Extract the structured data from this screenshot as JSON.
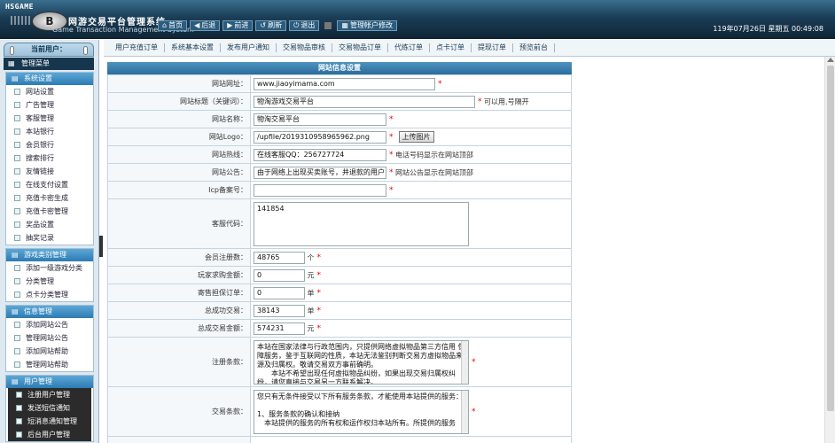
{
  "header": {
    "brand": "HSGAME",
    "logo_letter": "B",
    "title_cn": "网游交易平台管理系统",
    "title_en": "Game Transaction Management System",
    "nav": [
      {
        "icon": "⌂",
        "label": "首页"
      },
      {
        "icon": "◀",
        "label": "后退"
      },
      {
        "icon": "▶",
        "label": "前进"
      },
      {
        "icon": "↺",
        "label": "刷新"
      },
      {
        "icon": "⏻",
        "label": "退出"
      }
    ],
    "account_button": "管理帐户修改",
    "datetime": "119年07月26日 星期五 00:49:08"
  },
  "sidebar": {
    "current_user_label": "当前用户：",
    "menu_title": "管理菜单",
    "groups": [
      {
        "title": "系统设置",
        "items": [
          "网站设置",
          "广告管理",
          "客服管理",
          "本站银行",
          "会员银行",
          "搜索排行",
          "友情链接",
          "在线支付设置",
          "充值卡密生成",
          "充值卡密管理",
          "奖品设置",
          "抽奖记录"
        ]
      },
      {
        "title": "游戏类别管理",
        "items": [
          "添加一级游戏分类",
          "分类管理",
          "点卡分类管理"
        ]
      },
      {
        "title": "信息管理",
        "items": [
          "添加网站公告",
          "管理网站公告",
          "添加网站帮助",
          "管理网站帮助"
        ]
      },
      {
        "title": "用户管理",
        "items": [
          "注册用户管理",
          "发送短信通知",
          "短消息通知管理",
          "后台用户管理"
        ]
      }
    ]
  },
  "tabs": [
    "用户充值订单",
    "系统基本设置",
    "发布用户通知",
    "交易物品审核",
    "交易物品订单",
    "代练订单",
    "点卡订单",
    "提现订单",
    "预览前台"
  ],
  "form": {
    "caption": "网站信息设置",
    "rows": [
      {
        "label": "网站网址：",
        "value": "www.jiaoyimama.com",
        "width": 205,
        "req": true,
        "hint": ""
      },
      {
        "label": "网站标题（关键词）：",
        "value": "物淘游戏交易平台",
        "width": 250,
        "req": true,
        "hint": "可以用,号隔开"
      },
      {
        "label": "网站名称：",
        "value": "物淘交易平台",
        "width": 150,
        "req": true,
        "hint": ""
      },
      {
        "label": "网站Logo：",
        "value": "/upfile/2019310958965962.png",
        "width": 150,
        "req": true,
        "hint": "",
        "button": "上传图片"
      },
      {
        "label": "网站热线：",
        "value": "在线客服QQ：256727724",
        "width": 150,
        "req": true,
        "hint": "电话号码显示在网站顶部"
      },
      {
        "label": "网站公告：",
        "value": "由于网络上出现买卖账号，并退款的用户",
        "width": 150,
        "req": true,
        "hint": "网站公告显示在网站顶部"
      },
      {
        "label": "Icp备案号：",
        "value": "",
        "width": 150,
        "req": true,
        "hint": ""
      }
    ],
    "service_code_label": "客服代码：",
    "service_code_value": "141854",
    "numeric_rows": [
      {
        "label": "会员注册数：",
        "value": "48765",
        "unit": "个"
      },
      {
        "label": "玩家求购金额：",
        "value": "0",
        "unit": "元"
      },
      {
        "label": "寄售担保订单：",
        "value": "0",
        "unit": "单"
      },
      {
        "label": "总成功交易：",
        "value": "38143",
        "unit": "单"
      },
      {
        "label": "总成交易金额：",
        "value": "574231",
        "unit": "元"
      }
    ],
    "terms_label": "注册条款：",
    "terms_text": "本站在国家法律与行政范围内，只提供网络虚拟物品第三方信用 保障服务，鉴于互联网的性质，本站无法鉴别判断交易方虚拟物品来源及归属权。敬请交易双方事前确明。\n　　本站不希望出现任何虚拟物品纠纷，如果出现交易归属权纠纷，请您直接与交易另一方联系解决。",
    "trade_label": "交易条款：",
    "trade_text": "您只有无条件接受以下所有服务条款，才能使用本站提供的服务：\n\n1、服务条款的确认和接纳\n　本站提供的服务的所有权和运作权归本站所有。所提供的服务"
  }
}
